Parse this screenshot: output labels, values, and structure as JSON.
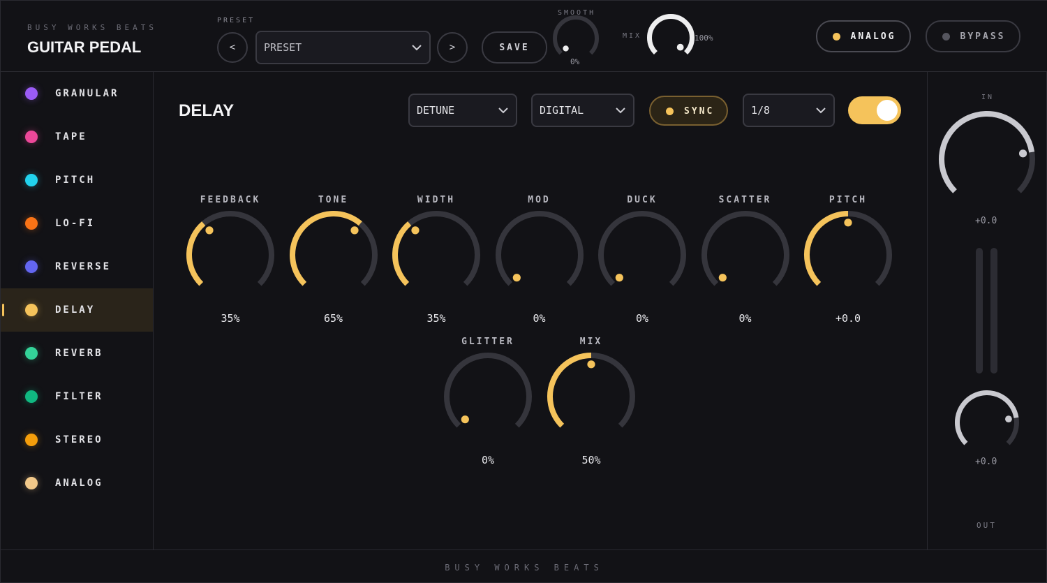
{
  "brand": {
    "subtitle": "BUSY WORKS BEATS",
    "title": "GUITAR PEDAL"
  },
  "header": {
    "preset_label": "PRESET",
    "prev": "<",
    "next": ">",
    "preset_value": "PRESET",
    "save": "SAVE",
    "smooth": {
      "label": "SMOOTH",
      "value": "0%",
      "level": 0
    },
    "mix": {
      "label": "MIX",
      "value": "100%",
      "level": 1
    },
    "analog": {
      "label": "ANALOG",
      "led_color": "#f5c35b"
    },
    "bypass": {
      "label": "BYPASS",
      "led_color": "#55555e"
    }
  },
  "sidebar": {
    "items": [
      {
        "label": "GRANULAR",
        "color": "#9b5cf6"
      },
      {
        "label": "TAPE",
        "color": "#ec4899"
      },
      {
        "label": "PITCH",
        "color": "#22d3ee"
      },
      {
        "label": "LO-FI",
        "color": "#f97316"
      },
      {
        "label": "REVERSE",
        "color": "#6366f1"
      },
      {
        "label": "DELAY",
        "color": "#f5c35b",
        "active": true
      },
      {
        "label": "REVERB",
        "color": "#34d399"
      },
      {
        "label": "FILTER",
        "color": "#10b981"
      },
      {
        "label": "STEREO",
        "color": "#f59e0b"
      },
      {
        "label": "ANALOG",
        "color": "#f2c98a"
      }
    ]
  },
  "main": {
    "title": "DELAY",
    "mode_select": "DETUNE",
    "type_select": "DIGITAL",
    "sync": {
      "label": "SYNC"
    },
    "division_select": "1/8",
    "enabled": true,
    "accent": "#f5c35b",
    "knobs_row1": [
      {
        "label": "FEEDBACK",
        "value": "35%",
        "level": 0.35
      },
      {
        "label": "TONE",
        "value": "65%",
        "level": 0.65
      },
      {
        "label": "WIDTH",
        "value": "35%",
        "level": 0.35
      },
      {
        "label": "MOD",
        "value": "0%",
        "level": 0
      },
      {
        "label": "DUCK",
        "value": "0%",
        "level": 0
      },
      {
        "label": "SCATTER",
        "value": "0%",
        "level": 0
      },
      {
        "label": "PITCH",
        "value": "+0.0",
        "level": 0.5
      }
    ],
    "knobs_row2": [
      {
        "label": "GLITTER",
        "value": "0%",
        "level": 0
      },
      {
        "label": "MIX",
        "value": "50%",
        "level": 0.5
      }
    ]
  },
  "right_panel": {
    "in_label": "IN",
    "in_value": "+0.0",
    "in_level": 0.8,
    "out_value": "+0.0",
    "out_level": 0.8,
    "out_label": "OUT"
  },
  "footer": {
    "text": "BUSY WORKS BEATS"
  }
}
